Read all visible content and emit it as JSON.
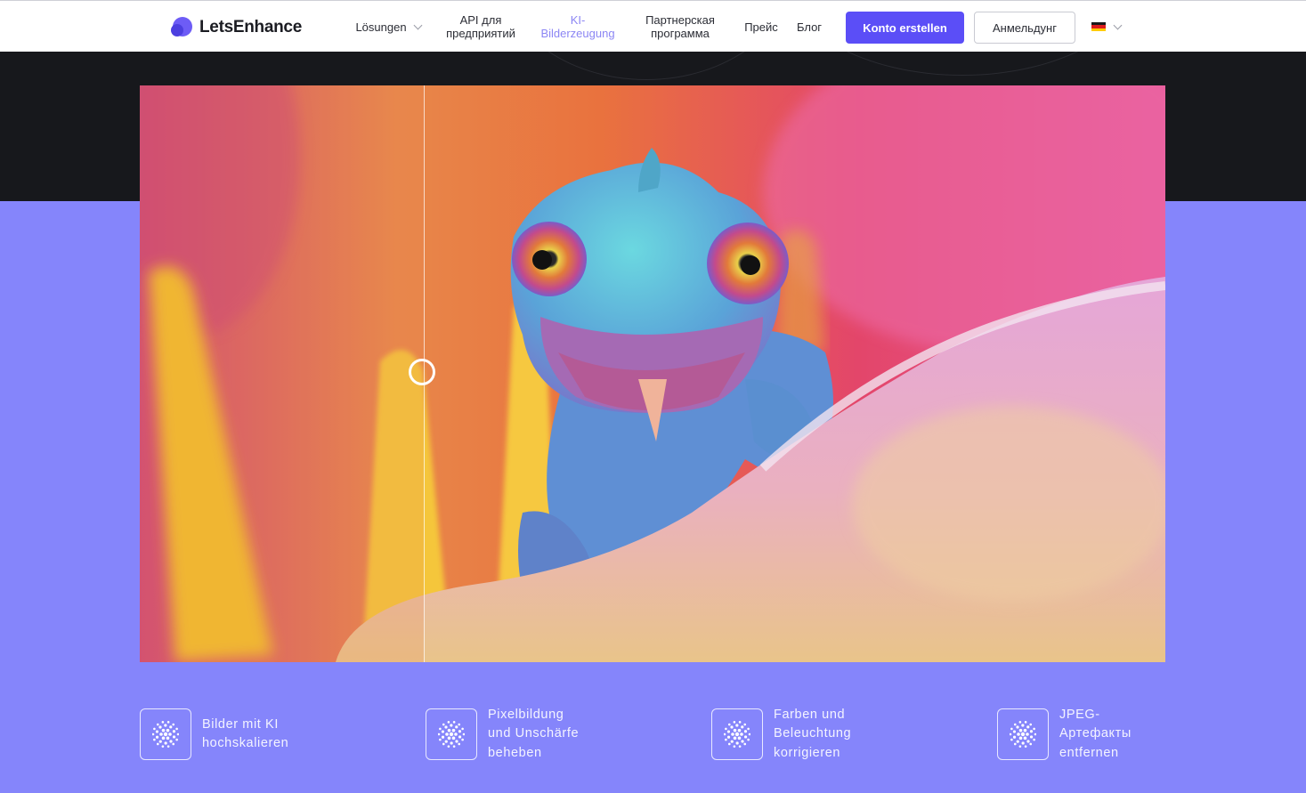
{
  "brand": {
    "name": "LetsEnhance"
  },
  "nav": {
    "solutions": "Lösungen",
    "api": "API для\nпредприятий",
    "ai_gen": "KI-\nBilderzeugung",
    "partner": "Партнерская\nпрограмма",
    "pricing": "Прейс",
    "blog": "Блог"
  },
  "actions": {
    "signup": "Konto erstellen",
    "login": "Анмельдунг"
  },
  "language": {
    "flag": "DE",
    "colors": [
      "#1a1a1a",
      "#dd1c1c",
      "#ffcc00"
    ]
  },
  "hero": {
    "compare_position": 0.277,
    "colors": {
      "dark": "#17181c",
      "accent_bg": "#8585fb"
    }
  },
  "features": [
    {
      "icon": "dots-circle-icon",
      "text": "Bilder mit KI\nhochskalieren"
    },
    {
      "icon": "dots-circle-icon",
      "text": "Pixelbildung\nund Unschärfe\nbeheben"
    },
    {
      "icon": "dots-circle-icon",
      "text": "Farben und\nBeleuchtung\nkorrigieren"
    },
    {
      "icon": "dots-circle-icon",
      "text": "JPEG-\nАртефакты\nentfernen"
    }
  ]
}
